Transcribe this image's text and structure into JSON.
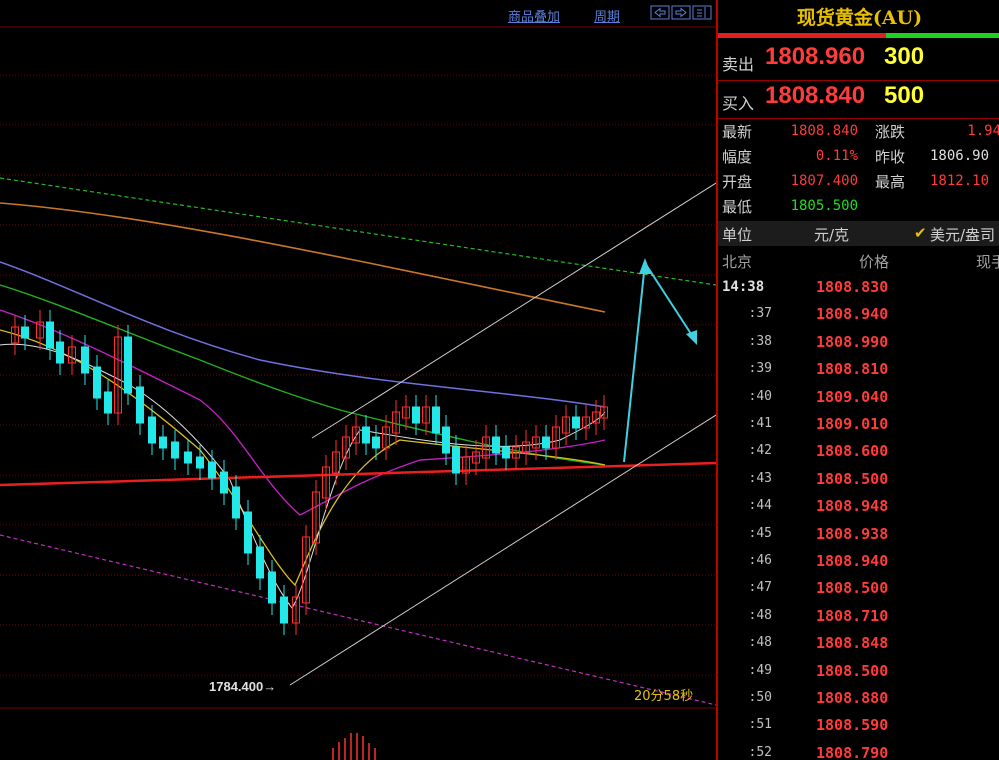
{
  "toolbar": {
    "overlay_label": "商品叠加",
    "period_label": "周期"
  },
  "chart": {
    "low_label": "1784.400",
    "timer_label": "20分58秒",
    "colors": {
      "up": "#ff3030",
      "down": "#22e8e8",
      "grid": "#7a0000",
      "ma_orange": "#c87828",
      "ma_blue": "#7070e0",
      "ma_green": "#20b020",
      "ma_purple": "#c020c0",
      "ma_yellow": "#d8c020",
      "ma_white": "#e0e0e0",
      "support_red": "#e82020",
      "trend_green": "#20c020",
      "trend_magenta": "#c030c0",
      "channel": "#d0d0d0",
      "arrow": "#40d0e0"
    }
  },
  "panel": {
    "title": "现货黄金(AU)",
    "sell": {
      "label": "卖出",
      "price": "1808.960",
      "volume": "300"
    },
    "buy": {
      "label": "买入",
      "price": "1808.840",
      "volume": "500"
    },
    "stats": {
      "latest_label": "最新",
      "latest": "1808.840",
      "change_label": "涨跌",
      "change": "1.94",
      "amplitude_label": "幅度",
      "amplitude": "0.11%",
      "prev_close_label": "昨收",
      "prev_close": "1806.90",
      "open_label": "开盘",
      "open": "1807.400",
      "high_label": "最高",
      "high": "1812.10",
      "low_label": "最低",
      "low": "1805.500"
    },
    "unit": {
      "label": "单位",
      "value": "元/克",
      "check": "✔",
      "currency": "美元/盎司"
    },
    "tick_header": {
      "time": "北京",
      "price": "价格",
      "volume": "现手"
    },
    "ticks": [
      {
        "time": "14:38",
        "price": "1808.830"
      },
      {
        "time": ":37",
        "price": "1808.940"
      },
      {
        "time": ":38",
        "price": "1808.990"
      },
      {
        "time": ":39",
        "price": "1808.810"
      },
      {
        "time": ":40",
        "price": "1809.040"
      },
      {
        "time": ":41",
        "price": "1809.010"
      },
      {
        "time": ":42",
        "price": "1808.600"
      },
      {
        "time": ":43",
        "price": "1808.500"
      },
      {
        "time": ":44",
        "price": "1808.948"
      },
      {
        "time": ":45",
        "price": "1808.938"
      },
      {
        "time": ":46",
        "price": "1808.940"
      },
      {
        "time": ":47",
        "price": "1808.500"
      },
      {
        "time": ":48",
        "price": "1808.710"
      },
      {
        "time": ":48",
        "price": "1808.848"
      },
      {
        "time": ":49",
        "price": "1808.500"
      },
      {
        "time": ":50",
        "price": "1808.880"
      },
      {
        "time": ":51",
        "price": "1808.590"
      },
      {
        "time": ":52",
        "price": "1808.790"
      }
    ]
  }
}
